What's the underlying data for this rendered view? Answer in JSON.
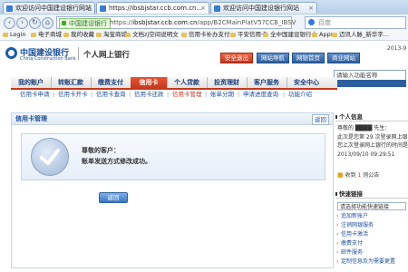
{
  "browser": {
    "tabs": [
      {
        "label": "欢迎访问中国建设银行网站"
      },
      {
        "label": "https://ibsbjstar.ccb.com.cn..."
      },
      {
        "label": "欢迎访问中国建设银行网站"
      }
    ],
    "secure_label": "中国建设银行",
    "url_prefix": "https://",
    "url_host": "ibsbjstar.ccb.com.cn",
    "url_path": "/app/B2CMainPlatV5?CCB_IBSV",
    "search_placeholder": "百度",
    "bookmarks": [
      "Login",
      "电子商城",
      "我的收藏",
      "淘宝商城",
      "文档zj空间说明文",
      "信用卡补办支付",
      "平安信用卡",
      "全中国建设银行人",
      "Apps",
      "迈讯人脉_新华字..."
    ]
  },
  "header": {
    "bank_name": "中国建设银行",
    "bank_en": "China Construction Bank",
    "portal": "个人网上银行",
    "date": "2013-9",
    "quick_links": [
      "安全退出",
      "网站导航",
      "网银首页",
      "商业网站"
    ],
    "shortcut_placeholder": "请输入功能名称"
  },
  "nav": {
    "tabs": [
      "我的账户",
      "转账汇款",
      "缴费支付",
      "信用卡",
      "个人贷款",
      "投资理财",
      "客户服务",
      "安全中心"
    ],
    "active_index": 3,
    "subnav": [
      "信用卡申请",
      "信用卡开卡",
      "信用卡查询",
      "信用卡还款",
      "信用卡管理",
      "账单分期",
      "申请进度查询",
      "功能介绍"
    ],
    "sub_active_index": 4
  },
  "panel": {
    "title": "信用卡管理",
    "back_label": "返回",
    "msg_line1": "尊敬的客户：",
    "msg_line2": "账单发送方式修改成功。",
    "return_label": "返回"
  },
  "sidebar": {
    "info_title": "个人信息",
    "greeting": "尊敬的 ████ 先生：",
    "login_line1": "此次是您第 29 次登录网上银",
    "login_line2": "您上次登录网上银行的时间是",
    "login_time": "2013/09/10 09:29:51",
    "collect_label": "收到",
    "collect_count": "1",
    "collect_suffix": "则公告",
    "quick_title": "快速链接",
    "select_label": "请选择功能快速链接",
    "links": [
      "追加新账户",
      "注销网银服务",
      "信用卡激活",
      "缴费支付",
      "邮件服务",
      "定制信息及为需要更置"
    ]
  }
}
